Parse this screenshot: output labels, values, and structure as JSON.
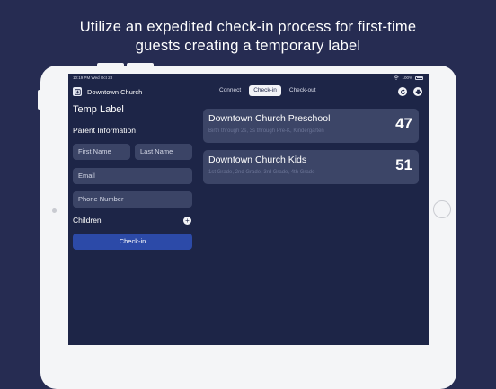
{
  "headline": {
    "line1": "Utilize an expedited check-in process for first-time",
    "line2": "guests creating a temporary label"
  },
  "status_bar": {
    "left": "10:19 PM   Wed Oct 23",
    "battery": "100%"
  },
  "header": {
    "organization": "Downtown Church",
    "tabs": [
      {
        "label": "Connect",
        "active": false
      },
      {
        "label": "Check-in",
        "active": true
      },
      {
        "label": "Check-out",
        "active": false
      }
    ],
    "icons": [
      "refresh-icon",
      "printer-icon"
    ]
  },
  "form": {
    "title": "Temp Label",
    "parent_section": "Parent Information",
    "first_name_placeholder": "First Name",
    "last_name_placeholder": "Last Name",
    "email_placeholder": "Email",
    "phone_placeholder": "Phone Number",
    "children_label": "Children",
    "add_symbol": "+",
    "submit_label": "Check-in"
  },
  "groups": [
    {
      "name": "Downtown Church Preschool",
      "description": "Birth through 2s, 3s through Pre-K, Kindergarten",
      "count": "47"
    },
    {
      "name": "Downtown Church Kids",
      "description": "1st Grade, 2nd Grade, 3rd Grade, 4th Grade",
      "count": "51"
    }
  ],
  "colors": {
    "page_background": "#262c52",
    "screen_background": "#1d2547",
    "field_background": "#3b4466",
    "card_background": "#3c4567",
    "primary_button": "#2c4aa8"
  }
}
